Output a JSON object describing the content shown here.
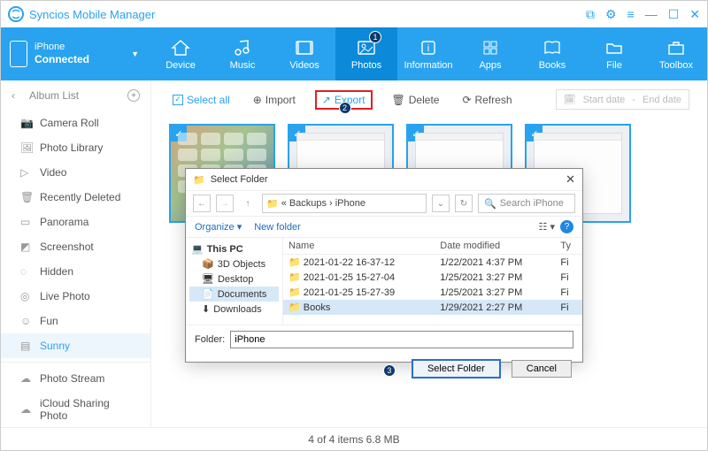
{
  "app": {
    "title": "Syncios Mobile Manager"
  },
  "device": {
    "name": "iPhone",
    "status": "Connected"
  },
  "nav": [
    {
      "label": "Device"
    },
    {
      "label": "Music"
    },
    {
      "label": "Videos"
    },
    {
      "label": "Photos"
    },
    {
      "label": "Information"
    },
    {
      "label": "Apps"
    },
    {
      "label": "Books"
    },
    {
      "label": "File"
    },
    {
      "label": "Toolbox"
    }
  ],
  "sidebar": {
    "header": "Album List",
    "items": [
      "Camera Roll",
      "Photo Library",
      "Video",
      "Recently Deleted",
      "Panorama",
      "Screenshot",
      "Hidden",
      "Live Photo",
      "Fun",
      "Sunny",
      "Photo Stream",
      "iCloud Sharing Photo"
    ]
  },
  "toolbar": {
    "select_all": "Select all",
    "import": "Import",
    "export": "Export",
    "delete": "Delete",
    "refresh": "Refresh",
    "start_date": "Start date",
    "end_date": "End date"
  },
  "annotations": {
    "a1": "1",
    "a2": "2",
    "a3": "3"
  },
  "dialog": {
    "title": "Select Folder",
    "breadcrumb_parts": [
      "«",
      "Backups",
      "›",
      "iPhone"
    ],
    "search_placeholder": "Search iPhone",
    "organize": "Organize ▾",
    "new_folder": "New folder",
    "tree": [
      "This PC",
      "3D Objects",
      "Desktop",
      "Documents",
      "Downloads"
    ],
    "cols": {
      "name": "Name",
      "date": "Date modified",
      "type": "Ty"
    },
    "rows": [
      {
        "name": "2021-01-22 16-37-12",
        "date": "1/22/2021 4:37 PM",
        "type": "Fi"
      },
      {
        "name": "2021-01-25 15-27-04",
        "date": "1/25/2021 3:27 PM",
        "type": "Fi"
      },
      {
        "name": "2021-01-25 15-27-39",
        "date": "1/25/2021 3:27 PM",
        "type": "Fi"
      },
      {
        "name": "Books",
        "date": "1/29/2021 2:27 PM",
        "type": "Fi"
      }
    ],
    "folder_label": "Folder:",
    "folder_value": "iPhone",
    "select_btn": "Select Folder",
    "cancel_btn": "Cancel"
  },
  "status": "4 of 4 items 6.8 MB"
}
